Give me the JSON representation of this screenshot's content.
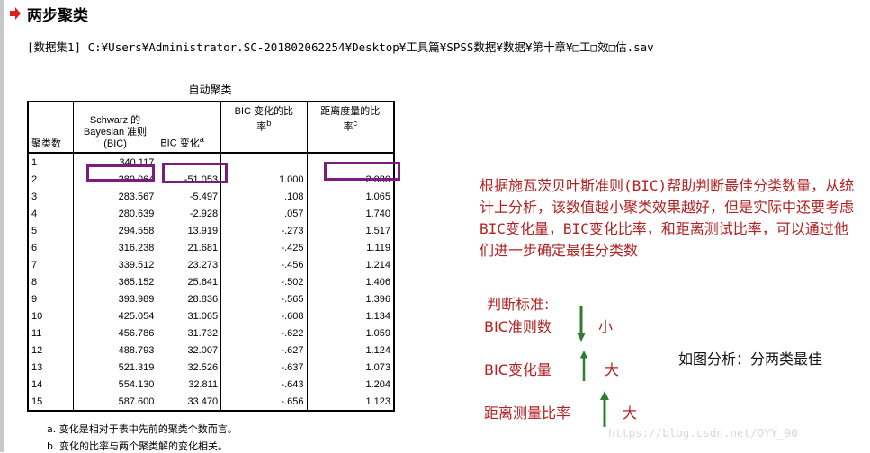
{
  "header": {
    "title": "两步聚类"
  },
  "dataset_line": "[数据集1] C:¥Users¥Administrator.SC-201802062254¥Desktop¥工具篇¥SPSS数据¥数据¥第十章¥□工□效□估.sav",
  "table": {
    "title": "自动聚类",
    "row_header": "聚类数",
    "columns": [
      {
        "lines": [
          "Schwarz 的",
          "Bayesian 准则",
          "(BIC)"
        ],
        "sup": ""
      },
      {
        "lines": [
          "BIC 变化"
        ],
        "sup": "a"
      },
      {
        "lines": [
          "BIC 变化的比",
          "率"
        ],
        "sup": "b"
      },
      {
        "lines": [
          "距离度量的比",
          "率"
        ],
        "sup": "c"
      }
    ],
    "rows": [
      [
        "1",
        "340.117",
        "",
        "",
        ""
      ],
      [
        "2",
        "289.064",
        "-51.053",
        "1.000",
        "2.080"
      ],
      [
        "3",
        "283.567",
        "-5.497",
        ".108",
        "1.065"
      ],
      [
        "4",
        "280.639",
        "-2.928",
        ".057",
        "1.740"
      ],
      [
        "5",
        "294.558",
        "13.919",
        "-.273",
        "1.517"
      ],
      [
        "6",
        "316.238",
        "21.681",
        "-.425",
        "1.119"
      ],
      [
        "7",
        "339.512",
        "23.273",
        "-.456",
        "1.214"
      ],
      [
        "8",
        "365.152",
        "25.641",
        "-.502",
        "1.406"
      ],
      [
        "9",
        "393.989",
        "28.836",
        "-.565",
        "1.396"
      ],
      [
        "10",
        "425.054",
        "31.065",
        "-.608",
        "1.134"
      ],
      [
        "11",
        "456.786",
        "31.732",
        "-.622",
        "1.059"
      ],
      [
        "12",
        "488.793",
        "32.007",
        "-.627",
        "1.124"
      ],
      [
        "13",
        "521.319",
        "32.526",
        "-.637",
        "1.073"
      ],
      [
        "14",
        "554.130",
        "32.811",
        "-.643",
        "1.204"
      ],
      [
        "15",
        "587.600",
        "33.470",
        "-.656",
        "1.123"
      ]
    ],
    "footnotes": [
      "a. 变化是相对于表中先前的聚类个数而言。",
      "b. 变化的比率与两个聚类解的变化相关。"
    ]
  },
  "annotation": {
    "explanation": "根据施瓦茨贝叶斯准则(BIC)帮助判断最佳分类数量，从统计上分析，该数值越小聚类效果越好，但是实际中还要考虑BIC变化量，BIC变化比率，和距离测试比率，可以通过他们进一步确定最佳分类数",
    "criteria_title": "判断标准:",
    "criteria": [
      {
        "label": "BIC准则数",
        "value": "小",
        "direction": "down"
      },
      {
        "label": "BIC变化量",
        "value": "大",
        "direction": "up"
      },
      {
        "label": "距离测量比率",
        "value": "大",
        "direction": "up"
      }
    ],
    "conclusion": "如图分析：分两类最佳",
    "highlight_color": "#7b1e7b",
    "text_color": "#b22222",
    "arrow_color": "#2e7d32"
  },
  "watermark": "https://blog.csdn.net/OYY_90"
}
